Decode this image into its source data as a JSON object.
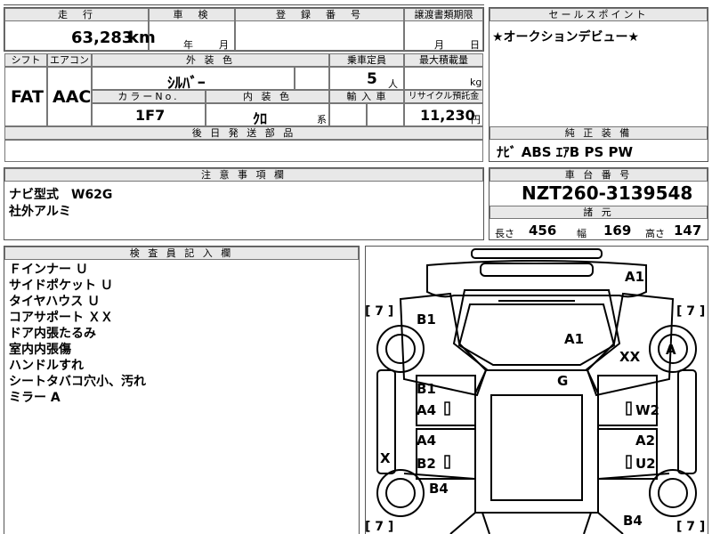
{
  "top": {
    "mileage_header": "走　行",
    "mileage_value": "63,283",
    "mileage_unit": "km",
    "inspection_header": "車　検",
    "inspection_year": "年",
    "inspection_month": "月",
    "registration_header": "登　録　番　号",
    "transfer_header": "譲渡書類期限",
    "transfer_month": "月",
    "transfer_day": "日"
  },
  "sales_point": {
    "header": "セールスポイント",
    "text": "★オークションデビュー★"
  },
  "spec": {
    "shift_header": "シフト",
    "shift_value": "FAT",
    "aircon_header": "エアコン",
    "aircon_value": "AAC",
    "ext_color_header": "外 装 色",
    "ext_color_value": "ｼﾙﾊﾞｰ",
    "capacity_header": "乗車定員",
    "capacity_value": "5",
    "capacity_unit": "人",
    "load_header": "最大積載量",
    "load_unit": "kg",
    "color_no_header": "カラーNo.",
    "color_no_value": "1F7",
    "int_color_header": "内 装 色",
    "int_color_value": "ｸﾛ",
    "int_color_suffix": "系",
    "import_header": "輸 入 車",
    "recycle_header": "リサイクル預託金",
    "recycle_value": "11,230",
    "recycle_unit": "円",
    "parts_header": "後 日 発 送 部 品"
  },
  "equipment": {
    "header": "純 正 装 備",
    "value": "ﾅﾋﾞ ABS ｴｱB PS PW"
  },
  "notes": {
    "header": "注 意 事 項 欄",
    "lines": [
      "ナビ型式　W62G",
      "社外アルミ"
    ]
  },
  "chassis": {
    "header": "車 台 番 号",
    "value": "NZT260-3139548",
    "dims_header": "諸 元",
    "length_label": "長さ",
    "length_value": "456",
    "width_label": "幅",
    "width_value": "169",
    "height_label": "高さ",
    "height_value": "147"
  },
  "inspector": {
    "header": "検 査 員 記 入 欄",
    "lines": [
      "Ｆインナー Ｕ",
      "サイドポケット Ｕ",
      "タイヤハウス Ｕ",
      "コアサポート ＸＸ",
      "ドア内張たるみ",
      "室内内張傷",
      "ハンドルすれ",
      "シートタバコ穴小、汚れ",
      "ミラー A"
    ]
  },
  "diagram": {
    "marks": {
      "front": "A1",
      "hood": "A1",
      "roof_mark": "G",
      "fender_left": "B1",
      "fender_right_xx": "XX",
      "wheel_right": "A",
      "door_fl_top": "B1",
      "door_fl_bottom": "A4",
      "door_fr": "W2",
      "door_rl_top": "A4",
      "door_rl_bottom": "B2",
      "door_rr_top": "A2",
      "door_rr_bottom": "U2",
      "sill_left": "X",
      "quarter_left": "B4",
      "rear_right": "B4"
    },
    "tire_tl": "[ 7 ]",
    "tire_tr": "[ 7 ]",
    "tire_bl": "[ 7 ]",
    "tire_br": "[ 7 ]"
  }
}
